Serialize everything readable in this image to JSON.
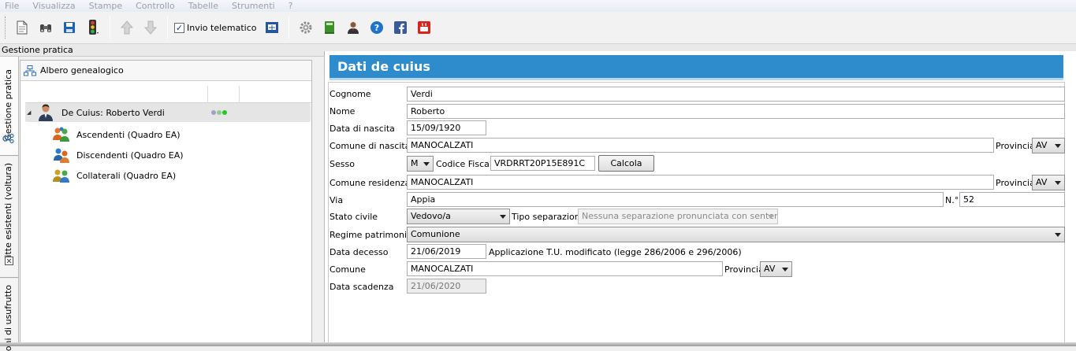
{
  "menu": [
    "File",
    "Visualizza",
    "Stampe",
    "Controllo",
    "Tabelle",
    "Strumenti",
    "?"
  ],
  "toolbar": {
    "icons": [
      "new-document-icon",
      "binoculars-icon",
      "save-icon",
      "traffic-light-icon",
      "arrow-up-icon",
      "arrow-down-icon",
      "telematic-send-icon",
      "gear-icon",
      "green-book-icon",
      "user-icon",
      "help-icon",
      "facebook-icon",
      "youtube-icon"
    ],
    "invio_telematico_label": "Invio telematico",
    "invio_telematico_checked": "✓"
  },
  "gestione_pratica_label": "Gestione pratica",
  "vertical_tabs": [
    "Gestione pratica",
    "Ditte esistenti (voltura)",
    "oni di usufrutto"
  ],
  "tree": {
    "header_label": "Albero genealogico",
    "root": {
      "label": "De Cuius: Roberto Verdi",
      "expander": "◢"
    },
    "children": [
      {
        "label": "Ascendenti (Quadro EA)"
      },
      {
        "label": "Discendenti (Quadro EA)"
      },
      {
        "label": "Collaterali (Quadro EA)"
      }
    ],
    "status_colors": [
      "#a0a0c8",
      "#8ad08a",
      "#1fcc1f"
    ]
  },
  "form": {
    "title": "Dati de cuius",
    "accent": "#2e8ccc",
    "cognome": {
      "label": "Cognome",
      "value": "Verdi"
    },
    "nome": {
      "label": "Nome",
      "value": "Roberto"
    },
    "data_nascita": {
      "label": "Data di nascita",
      "value": "15/09/1920"
    },
    "comune_nascita": {
      "label": "Comune di nascita",
      "value": "MANOCALZATI",
      "provincia_label": "Provincia",
      "provincia": "AV"
    },
    "sesso": {
      "label": "Sesso",
      "value": "M",
      "cf_label": "Codice Fiscale",
      "cf_value": "VRDRRT20P15E891C",
      "calcola": "Calcola"
    },
    "comune_residenza": {
      "label": "Comune residenza",
      "value": "MANOCALZATI",
      "provincia_label": "Provincia",
      "provincia": "AV"
    },
    "via": {
      "label": "Via",
      "value": "Appia",
      "numero_label": "N.°",
      "numero": "52"
    },
    "stato_civile": {
      "label": "Stato civile",
      "value": "Vedovo/a",
      "tipo_sep_label": "Tipo separazione",
      "tipo_sep_value": "Nessuna separazione pronunciata con sentenza"
    },
    "regime": {
      "label": "Regime patrimoniale",
      "value": "Comunione"
    },
    "data_decesso": {
      "label": "Data decesso",
      "value": "21/06/2019",
      "note": "Applicazione T.U. modificato (legge 286/2006 e 296/2006)"
    },
    "comune": {
      "label": "Comune",
      "value": "MANOCALZATI",
      "provincia_label": "Provincia",
      "provincia": "AV"
    },
    "data_scadenza": {
      "label": "Data scadenza",
      "value": "21/06/2020"
    }
  }
}
